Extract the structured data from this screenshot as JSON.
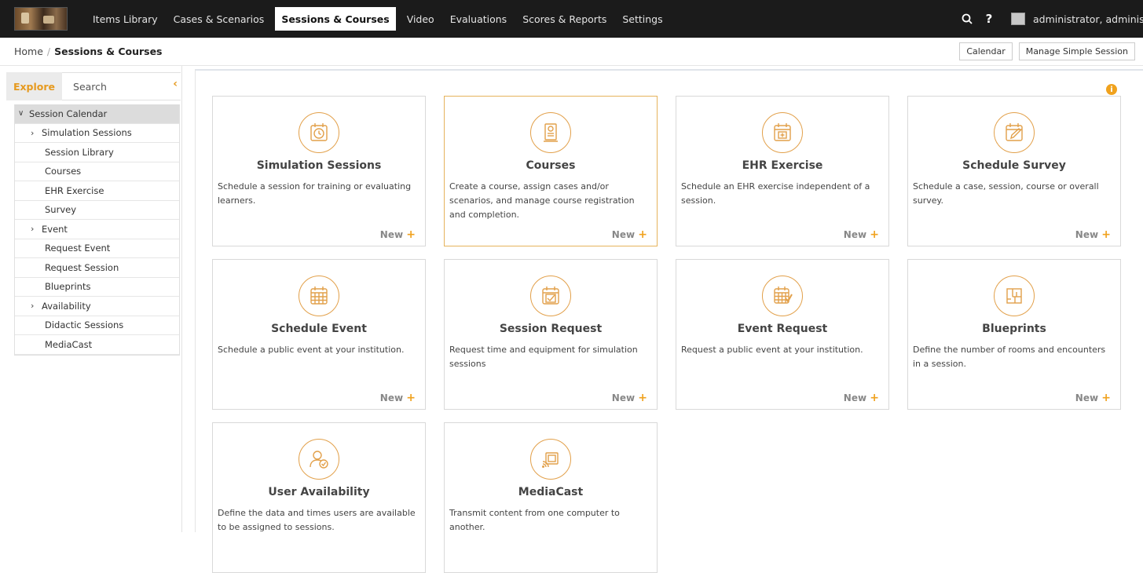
{
  "nav": {
    "items": [
      "Items Library",
      "Cases & Scenarios",
      "Sessions & Courses",
      "Video",
      "Evaluations",
      "Scores & Reports",
      "Settings"
    ],
    "active": "Sessions & Courses",
    "user": "administrator, administrato"
  },
  "breadcrumb": {
    "home": "Home",
    "separator": "/",
    "current": "Sessions & Courses"
  },
  "header_buttons": {
    "calendar": "Calendar",
    "manage": "Manage Simple Session"
  },
  "left_tabs": {
    "explore": "Explore",
    "search": "Search"
  },
  "tree": {
    "root": "Session Calendar",
    "items": [
      {
        "label": "Simulation Sessions",
        "expandable": true
      },
      {
        "label": "Session Library",
        "expandable": false
      },
      {
        "label": "Courses",
        "expandable": false
      },
      {
        "label": "EHR Exercise",
        "expandable": false
      },
      {
        "label": "Survey",
        "expandable": false
      },
      {
        "label": "Event",
        "expandable": true
      },
      {
        "label": "Request Event",
        "expandable": false
      },
      {
        "label": "Request Session",
        "expandable": false
      },
      {
        "label": "Blueprints",
        "expandable": false
      },
      {
        "label": "Availability",
        "expandable": true
      },
      {
        "label": "Didactic Sessions",
        "expandable": false
      },
      {
        "label": "MediaCast",
        "expandable": false
      }
    ]
  },
  "cards": [
    {
      "title": "Simulation Sessions",
      "desc": "Schedule a session for training or evaluating learners.",
      "new": "New",
      "icon": "clock-calendar-icon"
    },
    {
      "title": "Courses",
      "desc": "Create a course, assign cases and/or scenarios, and manage course registration and completion.",
      "new": "New",
      "icon": "certificate-icon"
    },
    {
      "title": "EHR Exercise",
      "desc": "Schedule an EHR exercise independent of a session.",
      "new": "New",
      "icon": "calendar-plus-icon"
    },
    {
      "title": "Schedule Survey",
      "desc": "Schedule a case, session, course or overall survey.",
      "new": "New",
      "icon": "calendar-edit-icon"
    },
    {
      "title": "Schedule Event",
      "desc": "Schedule a public event at your institution.",
      "new": "New",
      "icon": "calendar-grid-icon"
    },
    {
      "title": "Session Request",
      "desc": "Request time and equipment for simulation sessions",
      "new": "New",
      "icon": "calendar-check-icon"
    },
    {
      "title": "Event Request",
      "desc": "Request a public event at your institution.",
      "new": "New",
      "icon": "calendar-grid-check-icon"
    },
    {
      "title": "Blueprints",
      "desc": "Define the number of rooms and encounters in a session.",
      "new": "New",
      "icon": "blueprint-icon"
    },
    {
      "title": "User Availability",
      "desc": "Define the data and times users are available to be assigned to sessions.",
      "new": "New",
      "icon": "user-check-icon"
    },
    {
      "title": "MediaCast",
      "desc": "Transmit content from one computer to another.",
      "new": "New",
      "icon": "cast-icon"
    }
  ],
  "colors": {
    "accent": "#f0a21e",
    "topbar": "#1b1b1b",
    "icon_stroke": "#e2a04a"
  }
}
